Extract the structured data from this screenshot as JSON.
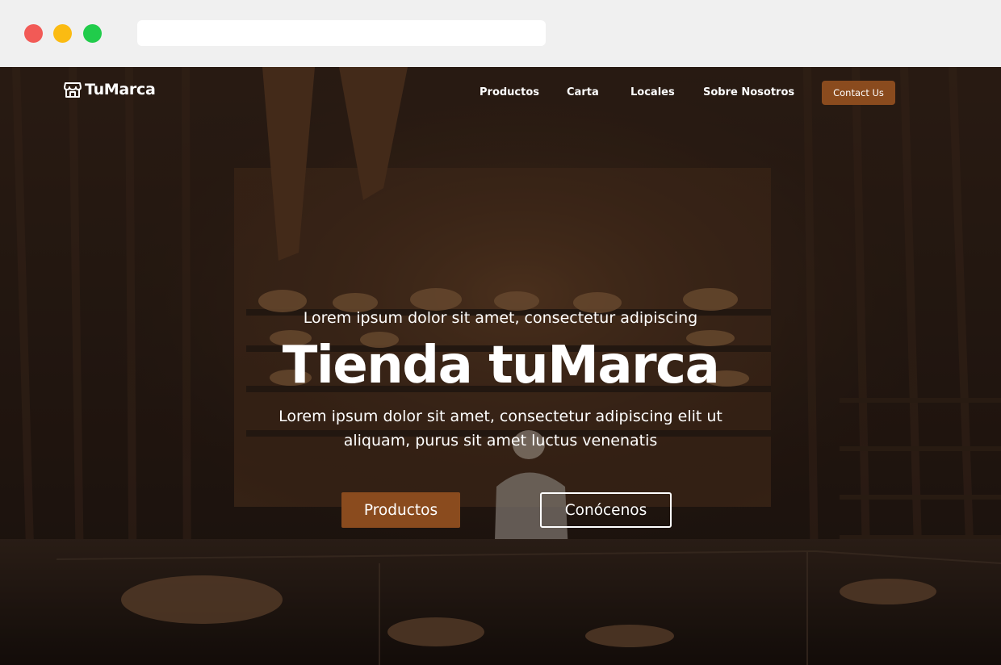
{
  "browser": {
    "address_bar_value": ""
  },
  "nav": {
    "logo_text": "TuMarca",
    "links": [
      "Productos",
      "Carta",
      "Locales",
      "Sobre Nosotros"
    ],
    "contact_label": "Contact Us"
  },
  "hero": {
    "kicker": "Lorem ipsum dolor sit amet, consectetur adipiscing",
    "title": "Tienda tuMarca",
    "subtitle": "Lorem ipsum dolor sit amet, consectetur adipiscing elit ut aliquam, purus sit amet luctus venenatis",
    "primary_button": "Productos",
    "secondary_button": "Conócenos"
  },
  "colors": {
    "accent": "#8a4b1e",
    "overlay": "#140e0a"
  },
  "icons": {
    "logo": "storefront-icon"
  }
}
